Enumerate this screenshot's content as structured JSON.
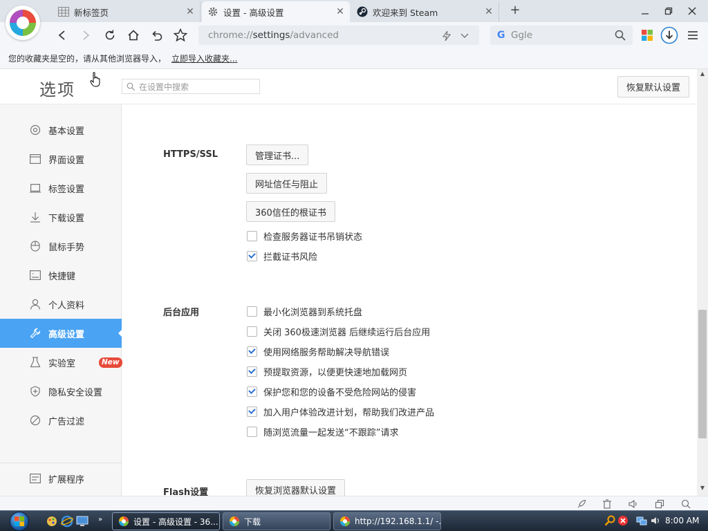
{
  "browser": {
    "tabs": [
      {
        "label": "新标签页",
        "icon": "grid-icon",
        "active": false
      },
      {
        "label": "设置 - 高级设置",
        "icon": "gear-icon",
        "active": true
      },
      {
        "label": "欢迎来到 Steam",
        "icon": "steam-icon",
        "active": false
      }
    ],
    "address": {
      "prefix": "chrome://",
      "host": "settings",
      "path": "/advanced"
    },
    "search_placeholder": "Ggle",
    "bookmarks_notice": "您的收藏夹是空的，请从其他浏览器导入，",
    "bookmarks_link": "立即导入收藏夹..."
  },
  "settings": {
    "title": "选项",
    "search_placeholder": "在设置中搜索",
    "reset_button": "恢复默认设置",
    "sidebar": [
      {
        "label": "基本设置",
        "icon": "circle-gear-icon"
      },
      {
        "label": "界面设置",
        "icon": "window-icon"
      },
      {
        "label": "标签设置",
        "icon": "tab-icon"
      },
      {
        "label": "下载设置",
        "icon": "download-icon"
      },
      {
        "label": "鼠标手势",
        "icon": "mouse-icon"
      },
      {
        "label": "快捷键",
        "icon": "keyboard-icon"
      },
      {
        "label": "个人资料",
        "icon": "person-icon"
      },
      {
        "label": "高级设置",
        "icon": "wrench-icon",
        "active": true
      },
      {
        "label": "实验室",
        "icon": "flask-icon",
        "badge": "New"
      },
      {
        "label": "隐私安全设置",
        "icon": "shield-icon"
      },
      {
        "label": "广告过滤",
        "icon": "block-icon"
      }
    ],
    "sidebar_bottom": {
      "label": "扩展程序",
      "icon": "extension-icon"
    },
    "https": {
      "label": "HTTPS/SSL",
      "buttons": [
        "管理证书...",
        "网址信任与阻止",
        "360信任的根证书"
      ],
      "checks": [
        {
          "label": "检查服务器证书吊销状态",
          "checked": false
        },
        {
          "label": "拦截证书风险",
          "checked": true
        }
      ]
    },
    "background": {
      "label": "后台应用",
      "checks": [
        {
          "label": "最小化浏览器到系统托盘",
          "checked": false
        },
        {
          "label": "关闭 360极速浏览器 后继续运行后台应用",
          "checked": false
        },
        {
          "label": "使用网络服务帮助解决导航错误",
          "checked": true
        },
        {
          "label": "预提取资源，以便更快速地加载网页",
          "checked": true
        },
        {
          "label": "保护您和您的设备不受危险网站的侵害",
          "checked": true
        },
        {
          "label": "加入用户体验改进计划，帮助我们改进产品",
          "checked": true
        },
        {
          "label": "随浏览流量一起发送“不跟踪”请求",
          "checked": false
        }
      ]
    },
    "flash": {
      "label": "Flash设置",
      "button": "恢复浏览器默认设置"
    }
  },
  "taskbar": {
    "buttons": [
      {
        "label": "设置 - 高级设置 - 36...",
        "active": true
      },
      {
        "label": "下载",
        "active": false
      },
      {
        "label": "http://192.168.1.1/ -...",
        "active": false
      }
    ],
    "clock": "8:00 AM"
  },
  "colors": {
    "accent": "#4aa3f3",
    "badge": "#e84a3a",
    "check": "#2b6fce"
  }
}
